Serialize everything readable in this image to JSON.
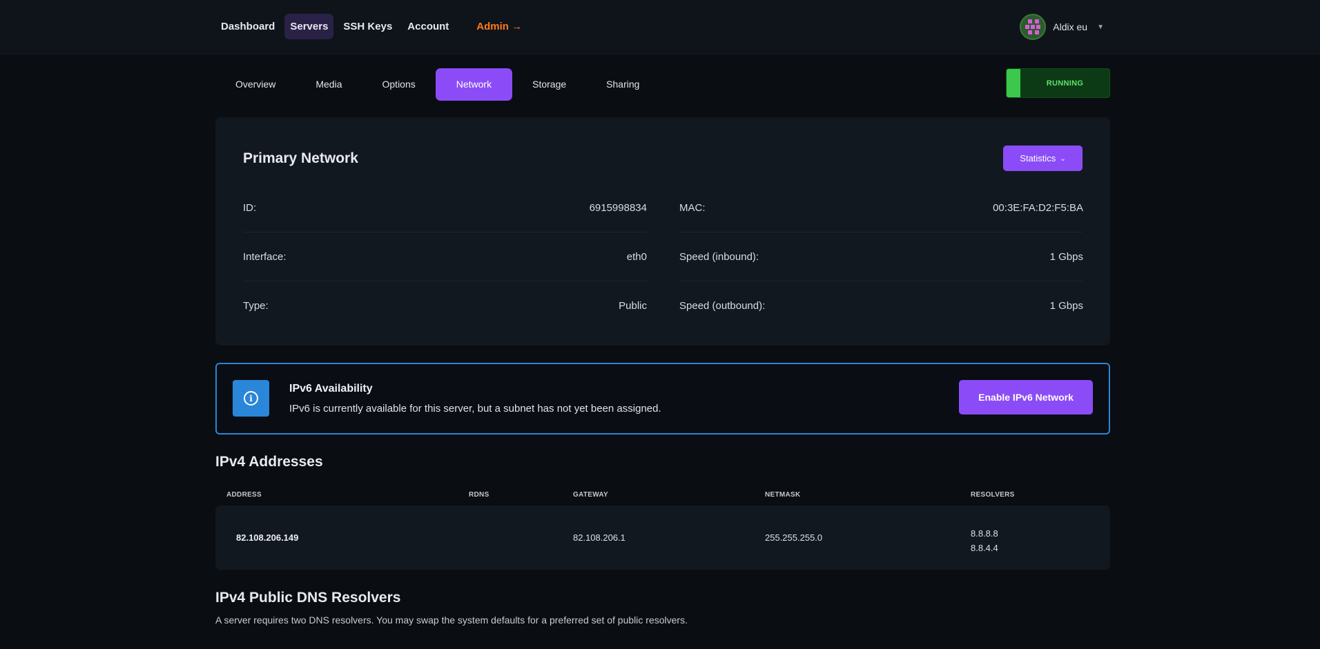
{
  "nav": {
    "links": [
      "Dashboard",
      "Servers",
      "SSH Keys",
      "Account"
    ],
    "admin": "Admin →",
    "user": "Aldix eu"
  },
  "tabs": [
    "Overview",
    "Media",
    "Options",
    "Network",
    "Storage",
    "Sharing"
  ],
  "status": "RUNNING",
  "network": {
    "title": "Primary Network",
    "stats_button": "Statistics",
    "left": [
      {
        "label": "ID:",
        "value": "6915998834"
      },
      {
        "label": "Interface:",
        "value": "eth0"
      },
      {
        "label": "Type:",
        "value": "Public"
      }
    ],
    "right": [
      {
        "label": "MAC:",
        "value": "00:3E:FA:D2:F5:BA"
      },
      {
        "label": "Speed (inbound):",
        "value": "1 Gbps"
      },
      {
        "label": "Speed (outbound):",
        "value": "1 Gbps"
      }
    ]
  },
  "ipv6": {
    "title": "IPv6 Availability",
    "text": "IPv6 is currently available for this server, but a subnet has not yet been assigned.",
    "button": "Enable IPv6 Network"
  },
  "ipv4": {
    "title": "IPv4 Addresses",
    "headers": [
      "ADDRESS",
      "RDNS",
      "GATEWAY",
      "NETMASK",
      "RESOLVERS"
    ],
    "row": {
      "address": "82.108.206.149",
      "rdns": "",
      "gateway": "82.108.206.1",
      "netmask": "255.255.255.0",
      "resolvers": [
        "8.8.8.8",
        "8.8.4.4"
      ]
    }
  },
  "dns": {
    "title": "IPv4 Public DNS Resolvers",
    "desc": "A server requires two DNS resolvers. You may swap the system defaults for a preferred set of public resolvers."
  },
  "colors": {
    "accent": "#8b4cf7",
    "info": "#2a86d8",
    "running": "#3cc84c",
    "admin": "#ff7a1a"
  }
}
